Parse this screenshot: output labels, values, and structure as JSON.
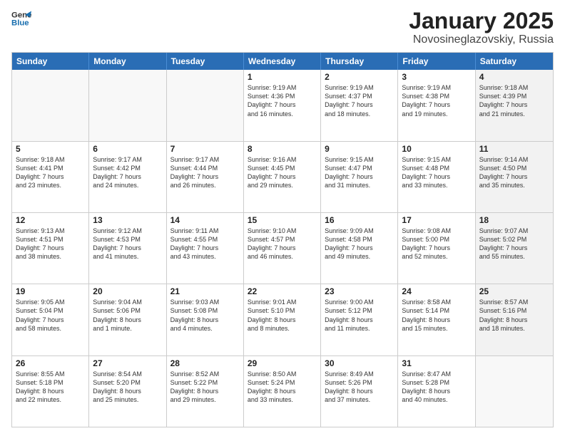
{
  "logo": {
    "line1": "General",
    "line2": "Blue"
  },
  "header": {
    "month": "January 2025",
    "location": "Novosineglazovskiy, Russia"
  },
  "days": [
    "Sunday",
    "Monday",
    "Tuesday",
    "Wednesday",
    "Thursday",
    "Friday",
    "Saturday"
  ],
  "rows": [
    [
      {
        "num": "",
        "text": "",
        "empty": true
      },
      {
        "num": "",
        "text": "",
        "empty": true
      },
      {
        "num": "",
        "text": "",
        "empty": true
      },
      {
        "num": "1",
        "text": "Sunrise: 9:19 AM\nSunset: 4:36 PM\nDaylight: 7 hours\nand 16 minutes."
      },
      {
        "num": "2",
        "text": "Sunrise: 9:19 AM\nSunset: 4:37 PM\nDaylight: 7 hours\nand 18 minutes."
      },
      {
        "num": "3",
        "text": "Sunrise: 9:19 AM\nSunset: 4:38 PM\nDaylight: 7 hours\nand 19 minutes."
      },
      {
        "num": "4",
        "text": "Sunrise: 9:18 AM\nSunset: 4:39 PM\nDaylight: 7 hours\nand 21 minutes.",
        "shaded": true
      }
    ],
    [
      {
        "num": "5",
        "text": "Sunrise: 9:18 AM\nSunset: 4:41 PM\nDaylight: 7 hours\nand 23 minutes."
      },
      {
        "num": "6",
        "text": "Sunrise: 9:17 AM\nSunset: 4:42 PM\nDaylight: 7 hours\nand 24 minutes."
      },
      {
        "num": "7",
        "text": "Sunrise: 9:17 AM\nSunset: 4:44 PM\nDaylight: 7 hours\nand 26 minutes."
      },
      {
        "num": "8",
        "text": "Sunrise: 9:16 AM\nSunset: 4:45 PM\nDaylight: 7 hours\nand 29 minutes."
      },
      {
        "num": "9",
        "text": "Sunrise: 9:15 AM\nSunset: 4:47 PM\nDaylight: 7 hours\nand 31 minutes."
      },
      {
        "num": "10",
        "text": "Sunrise: 9:15 AM\nSunset: 4:48 PM\nDaylight: 7 hours\nand 33 minutes."
      },
      {
        "num": "11",
        "text": "Sunrise: 9:14 AM\nSunset: 4:50 PM\nDaylight: 7 hours\nand 35 minutes.",
        "shaded": true
      }
    ],
    [
      {
        "num": "12",
        "text": "Sunrise: 9:13 AM\nSunset: 4:51 PM\nDaylight: 7 hours\nand 38 minutes."
      },
      {
        "num": "13",
        "text": "Sunrise: 9:12 AM\nSunset: 4:53 PM\nDaylight: 7 hours\nand 41 minutes."
      },
      {
        "num": "14",
        "text": "Sunrise: 9:11 AM\nSunset: 4:55 PM\nDaylight: 7 hours\nand 43 minutes."
      },
      {
        "num": "15",
        "text": "Sunrise: 9:10 AM\nSunset: 4:57 PM\nDaylight: 7 hours\nand 46 minutes."
      },
      {
        "num": "16",
        "text": "Sunrise: 9:09 AM\nSunset: 4:58 PM\nDaylight: 7 hours\nand 49 minutes."
      },
      {
        "num": "17",
        "text": "Sunrise: 9:08 AM\nSunset: 5:00 PM\nDaylight: 7 hours\nand 52 minutes."
      },
      {
        "num": "18",
        "text": "Sunrise: 9:07 AM\nSunset: 5:02 PM\nDaylight: 7 hours\nand 55 minutes.",
        "shaded": true
      }
    ],
    [
      {
        "num": "19",
        "text": "Sunrise: 9:05 AM\nSunset: 5:04 PM\nDaylight: 7 hours\nand 58 minutes."
      },
      {
        "num": "20",
        "text": "Sunrise: 9:04 AM\nSunset: 5:06 PM\nDaylight: 8 hours\nand 1 minute."
      },
      {
        "num": "21",
        "text": "Sunrise: 9:03 AM\nSunset: 5:08 PM\nDaylight: 8 hours\nand 4 minutes."
      },
      {
        "num": "22",
        "text": "Sunrise: 9:01 AM\nSunset: 5:10 PM\nDaylight: 8 hours\nand 8 minutes."
      },
      {
        "num": "23",
        "text": "Sunrise: 9:00 AM\nSunset: 5:12 PM\nDaylight: 8 hours\nand 11 minutes."
      },
      {
        "num": "24",
        "text": "Sunrise: 8:58 AM\nSunset: 5:14 PM\nDaylight: 8 hours\nand 15 minutes."
      },
      {
        "num": "25",
        "text": "Sunrise: 8:57 AM\nSunset: 5:16 PM\nDaylight: 8 hours\nand 18 minutes.",
        "shaded": true
      }
    ],
    [
      {
        "num": "26",
        "text": "Sunrise: 8:55 AM\nSunset: 5:18 PM\nDaylight: 8 hours\nand 22 minutes."
      },
      {
        "num": "27",
        "text": "Sunrise: 8:54 AM\nSunset: 5:20 PM\nDaylight: 8 hours\nand 25 minutes."
      },
      {
        "num": "28",
        "text": "Sunrise: 8:52 AM\nSunset: 5:22 PM\nDaylight: 8 hours\nand 29 minutes."
      },
      {
        "num": "29",
        "text": "Sunrise: 8:50 AM\nSunset: 5:24 PM\nDaylight: 8 hours\nand 33 minutes."
      },
      {
        "num": "30",
        "text": "Sunrise: 8:49 AM\nSunset: 5:26 PM\nDaylight: 8 hours\nand 37 minutes."
      },
      {
        "num": "31",
        "text": "Sunrise: 8:47 AM\nSunset: 5:28 PM\nDaylight: 8 hours\nand 40 minutes."
      },
      {
        "num": "",
        "text": "",
        "empty": true,
        "shaded": true
      }
    ]
  ]
}
